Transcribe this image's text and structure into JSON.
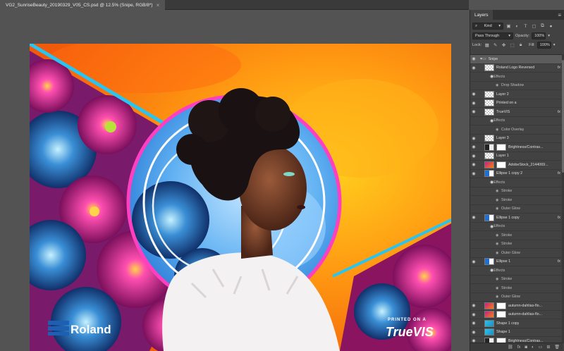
{
  "document": {
    "tab_title": "VG2_SunriseBeauty_20190329_V05_CS.psd @ 12.5% (Snipe, RGB/8*)",
    "close_glyph": "×"
  },
  "artwork": {
    "brand_logo_text": "Roland",
    "printed_on_text": "PRINTED ON A",
    "truevis_text": "TrueVIS",
    "colors": {
      "orange_sky": "#f5820e",
      "yellow": "#ffc21a",
      "ring_pink": "#ff3fc2",
      "circle_blue": "#4aa6ee",
      "diagonal_cyan": "#2ac4f0",
      "flower_magenta": "#c51e8c"
    }
  },
  "layers_panel": {
    "tab": "Layers",
    "filter_kind": "Kind",
    "blend_mode": "Pass Through",
    "opacity_label": "Opacity:",
    "opacity_value": "100%",
    "lock_label": "Lock:",
    "fill_label": "Fill:",
    "fill_value": "100%",
    "rows": [
      {
        "name": "Snipe",
        "type": "group",
        "selected": true
      },
      {
        "name": "Roland Logo Reversed",
        "type": "layer",
        "fx": true,
        "thumb": "checker"
      },
      {
        "name": "Effects",
        "type": "effects"
      },
      {
        "name": "Drop Shadow",
        "type": "effect"
      },
      {
        "name": "Layer 2",
        "type": "layer",
        "thumb": "checker"
      },
      {
        "name": "Printed on a",
        "type": "layer",
        "thumb": "checker"
      },
      {
        "name": "TrueVIS",
        "type": "layer",
        "fx": true,
        "thumb": "checker"
      },
      {
        "name": "Effects",
        "type": "effects"
      },
      {
        "name": "Color Overlay",
        "type": "effect"
      },
      {
        "name": "Layer 3",
        "type": "layer",
        "thumb": "checker"
      },
      {
        "name": "Brightness/Contras...",
        "type": "adjustment"
      },
      {
        "name": "Layer 1",
        "type": "layer",
        "thumb": "checker"
      },
      {
        "name": "AdobeStock_2144069...",
        "type": "photo"
      },
      {
        "name": "Ellipse 1 copy 2",
        "type": "layer",
        "fx": true,
        "thumb": "blue"
      },
      {
        "name": "Effects",
        "type": "effects"
      },
      {
        "name": "Stroke",
        "type": "effect"
      },
      {
        "name": "Stroke",
        "type": "effect"
      },
      {
        "name": "Outer Glow",
        "type": "effect"
      },
      {
        "name": "Ellipse 1 copy",
        "type": "layer",
        "fx": true,
        "thumb": "blue"
      },
      {
        "name": "Effects",
        "type": "effects"
      },
      {
        "name": "Stroke",
        "type": "effect"
      },
      {
        "name": "Stroke",
        "type": "effect"
      },
      {
        "name": "Outer Glow",
        "type": "effect"
      },
      {
        "name": "Ellipse 1",
        "type": "layer",
        "fx": true,
        "thumb": "blue"
      },
      {
        "name": "Effects",
        "type": "effects"
      },
      {
        "name": "Stroke",
        "type": "effect"
      },
      {
        "name": "Stroke",
        "type": "effect"
      },
      {
        "name": "Outer Glow",
        "type": "effect"
      },
      {
        "name": "autumn-dahlias-flo...",
        "type": "photo"
      },
      {
        "name": "autumn-dahlias-flo...",
        "type": "photo"
      },
      {
        "name": "Shape 1 copy",
        "type": "layer",
        "thumb": "cyan"
      },
      {
        "name": "Shape 1",
        "type": "layer",
        "thumb": "cyan"
      },
      {
        "name": "Brightness/Contras...",
        "type": "adjustment"
      }
    ]
  }
}
